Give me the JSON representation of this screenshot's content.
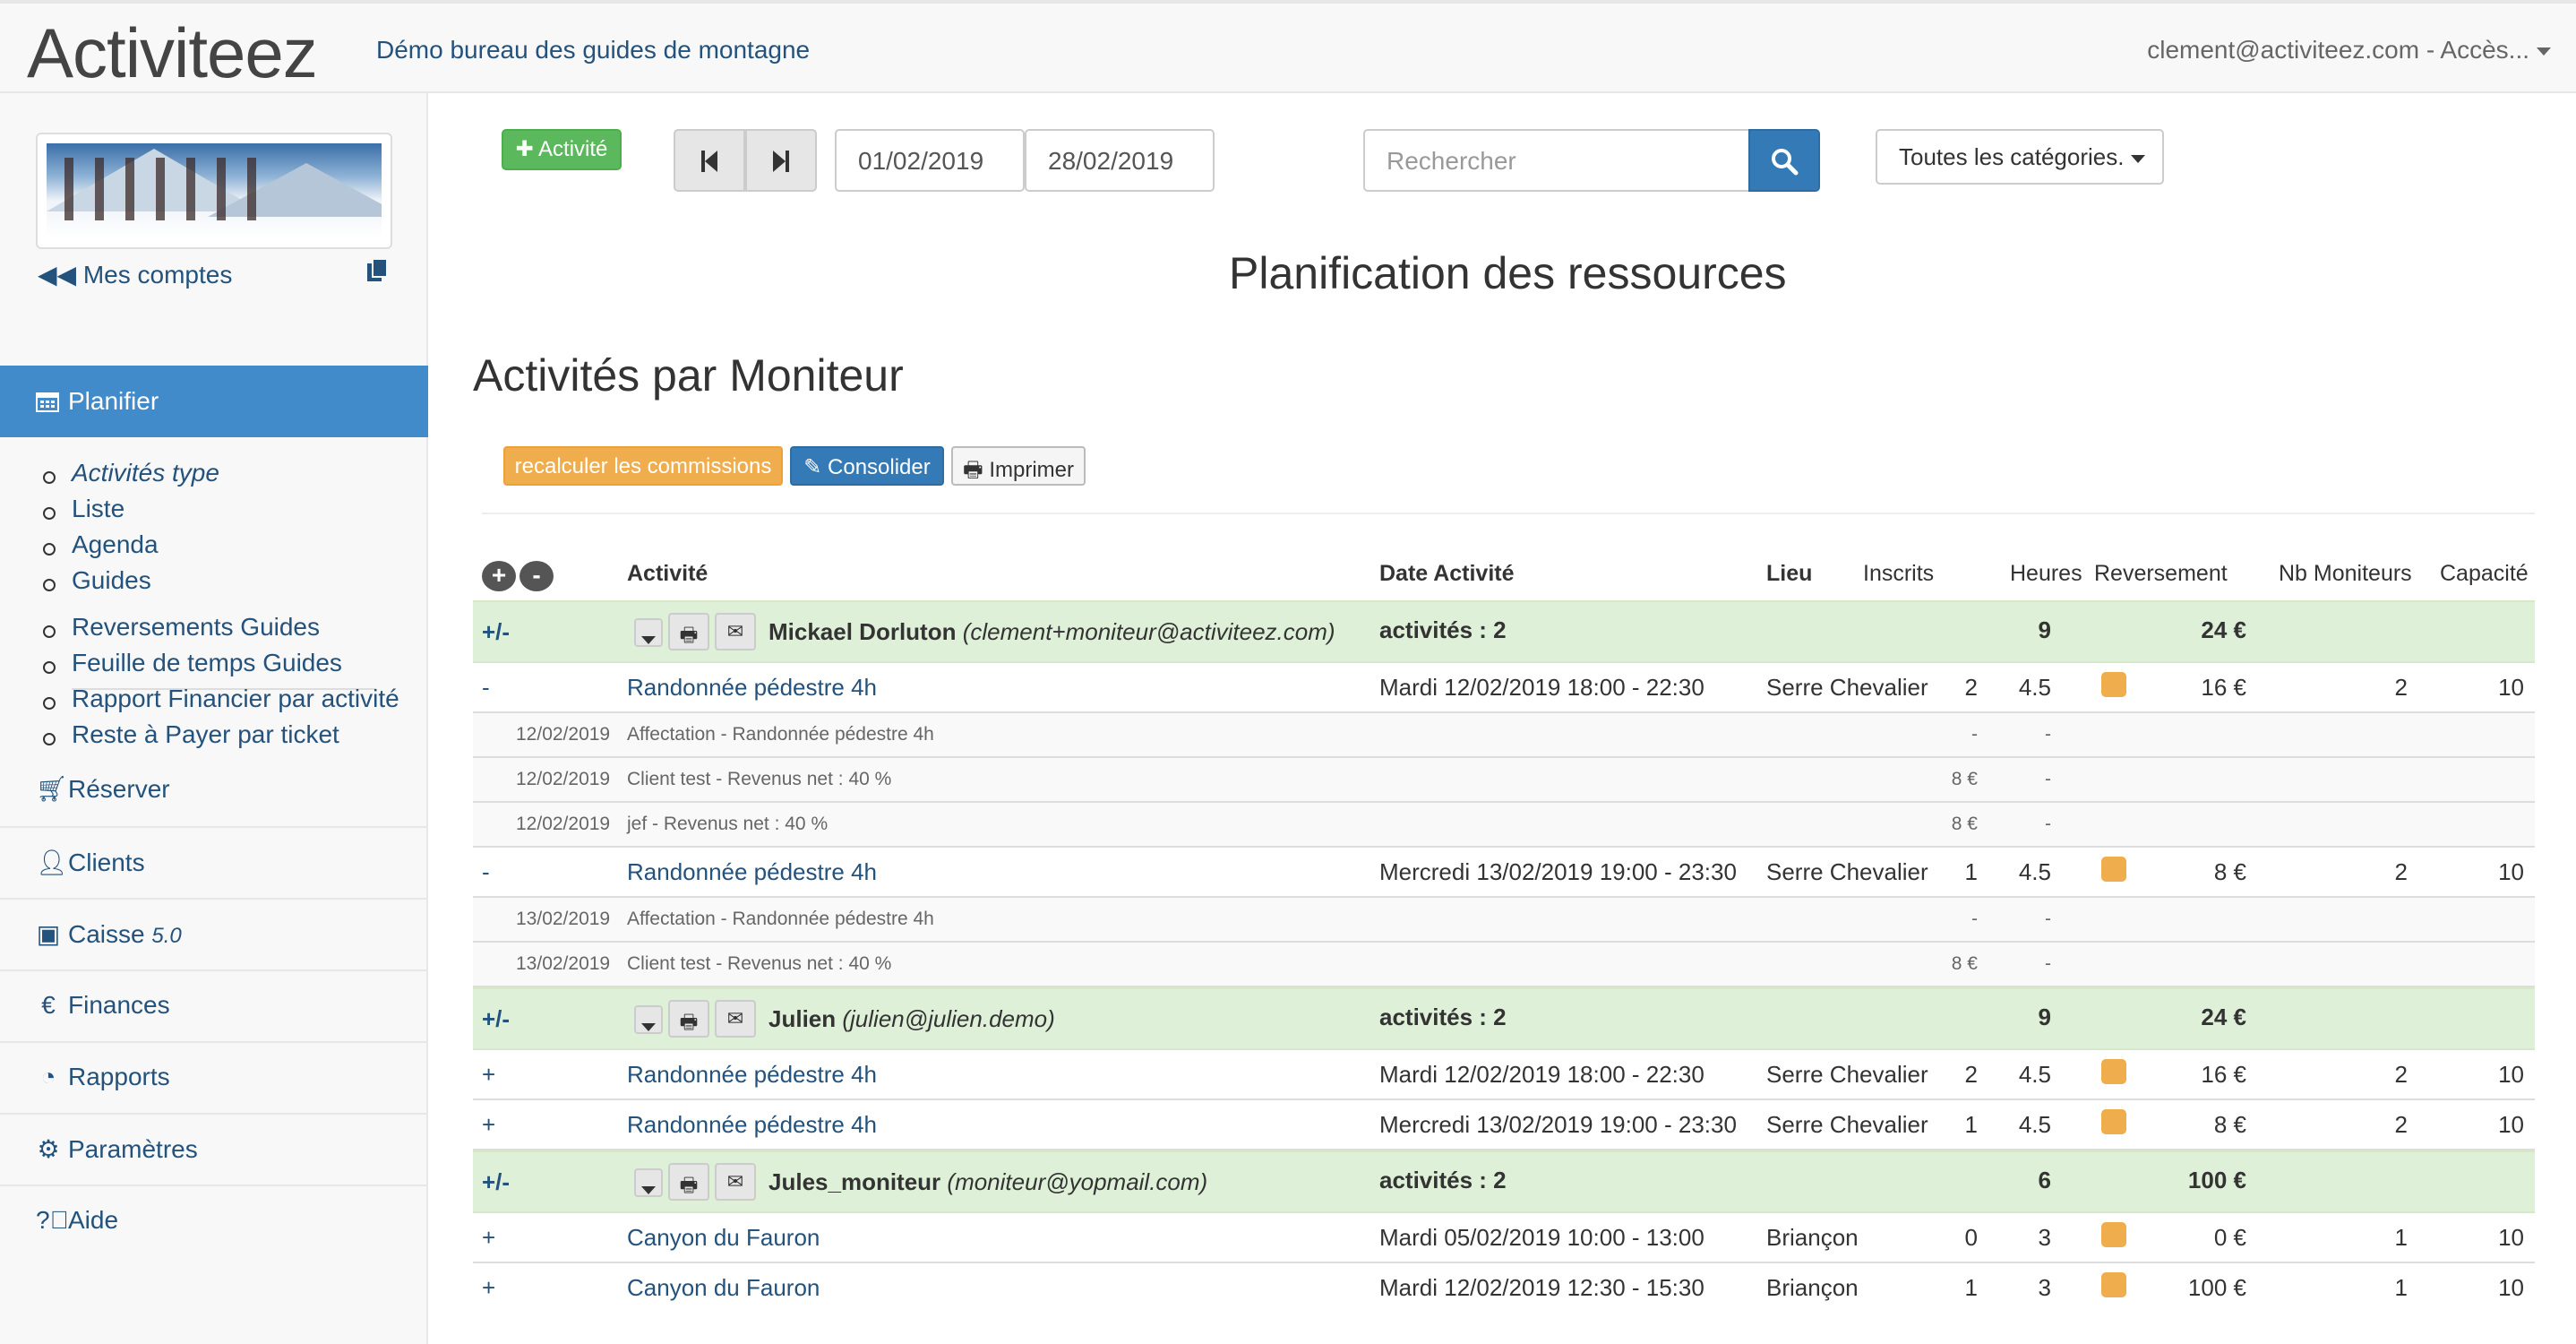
{
  "navbar": {
    "brand": "Activiteez",
    "subtitle": "Démo bureau des guides de montagne",
    "user": "clement@activiteez.com - Accès..."
  },
  "sidebar": {
    "accounts_label": "Mes comptes",
    "active_item": "Planifier",
    "sub_items": [
      "Activités type",
      "Liste",
      "Agenda",
      "Guides"
    ],
    "sub_items2": [
      "Reversements Guides",
      "Feuille de temps Guides",
      "Rapport Financier par activité",
      "Reste à Payer par ticket"
    ],
    "items": [
      {
        "label": "Réserver",
        "icon": "cart-icon"
      },
      {
        "label": "Clients",
        "icon": "user-icon"
      },
      {
        "label": "Caisse",
        "version": "5.0",
        "icon": "register-icon"
      },
      {
        "label": "Finances",
        "icon": "euro-icon"
      },
      {
        "label": "Rapports",
        "icon": "dashboard-icon"
      },
      {
        "label": "Paramètres",
        "icon": "gear-icon"
      },
      {
        "label": "Aide",
        "icon": "help-icon"
      }
    ]
  },
  "toolbar": {
    "add_label": "Activité",
    "date_from": "01/02/2019",
    "date_to": "28/02/2019",
    "search_placeholder": "Rechercher",
    "category": "Toutes les catégories."
  },
  "page_title": "Planification des ressources",
  "section_title": "Activités par Moniteur",
  "actions": {
    "recalc": "recalculer les commissions",
    "consolidate": "Consolider",
    "print": "Imprimer"
  },
  "table": {
    "headers": {
      "activite": "Activité",
      "date": "Date Activité",
      "lieu": "Lieu",
      "inscrits": "Inscrits",
      "heures": "Heures",
      "reversement": "Reversement",
      "nb_moniteurs": "Nb Moniteurs",
      "capacite": "Capacité"
    },
    "groups": [
      {
        "toggle": "+/-",
        "name": "Mickael Dorluton",
        "email": "(clement+moniteur@activiteez.com)",
        "count": "activités : 2",
        "hours": "9",
        "amount": "24 €"
      },
      {
        "toggle": "+/-",
        "name": "Julien",
        "email": "(julien@julien.demo)",
        "count": "activités : 2",
        "hours": "9",
        "amount": "24 €"
      },
      {
        "toggle": "+/-",
        "name": "Jules_moniteur",
        "email": "(moniteur@yopmail.com)",
        "count": "activités : 2",
        "hours": "6",
        "amount": "100 €"
      }
    ],
    "activities": [
      {
        "toggle": "-",
        "name": "Randonnée pédestre 4h",
        "date": "Mardi 12/02/2019 18:00 - 22:30",
        "lieu": "Serre Chevalier",
        "inscrits": "2",
        "heures": "4.5",
        "rev": "16 €",
        "nbm": "2",
        "cap": "10"
      },
      {
        "toggle": "-",
        "name": "Randonnée pédestre 4h",
        "date": "Mercredi 13/02/2019 19:00 - 23:30",
        "lieu": "Serre Chevalier",
        "inscrits": "1",
        "heures": "4.5",
        "rev": "8 €",
        "nbm": "2",
        "cap": "10"
      },
      {
        "toggle": "+",
        "name": "Randonnée pédestre 4h",
        "date": "Mardi 12/02/2019 18:00 - 22:30",
        "lieu": "Serre Chevalier",
        "inscrits": "2",
        "heures": "4.5",
        "rev": "16 €",
        "nbm": "2",
        "cap": "10"
      },
      {
        "toggle": "+",
        "name": "Randonnée pédestre 4h",
        "date": "Mercredi 13/02/2019 19:00 - 23:30",
        "lieu": "Serre Chevalier",
        "inscrits": "1",
        "heures": "4.5",
        "rev": "8 €",
        "nbm": "2",
        "cap": "10"
      },
      {
        "toggle": "+",
        "name": "Canyon du Fauron",
        "date": "Mardi 05/02/2019 10:00 - 13:00",
        "lieu": "Briançon",
        "inscrits": "0",
        "heures": "3",
        "rev": "0 €",
        "nbm": "1",
        "cap": "10"
      },
      {
        "toggle": "+",
        "name": "Canyon du Fauron",
        "date": "Mardi 12/02/2019 12:30 - 15:30",
        "lieu": "Briançon",
        "inscrits": "1",
        "heures": "3",
        "rev": "100 €",
        "nbm": "1",
        "cap": "10"
      }
    ],
    "details": [
      {
        "date": "12/02/2019",
        "label": "Affectation - Randonnée pédestre 4h",
        "amount": "-",
        "hours": "-"
      },
      {
        "date": "12/02/2019",
        "label": "Client test - Revenus net : 40 %",
        "amount": "8 €",
        "hours": "-"
      },
      {
        "date": "12/02/2019",
        "label": "jef - Revenus net : 40 %",
        "amount": "8 €",
        "hours": "-"
      },
      {
        "date": "13/02/2019",
        "label": "Affectation - Randonnée pédestre 4h",
        "amount": "-",
        "hours": "-"
      },
      {
        "date": "13/02/2019",
        "label": "Client test - Revenus net : 40 %",
        "amount": "8 €",
        "hours": "-"
      }
    ]
  }
}
